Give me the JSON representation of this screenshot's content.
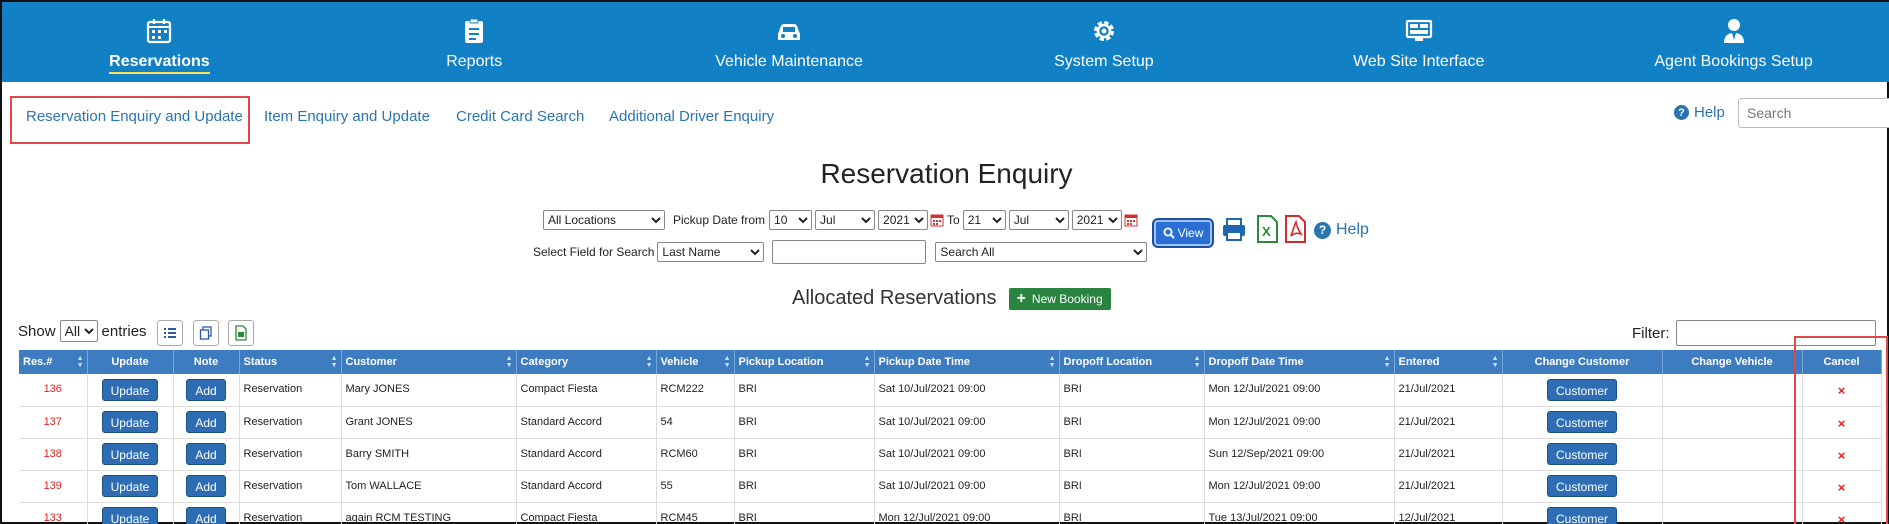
{
  "topnav": {
    "items": [
      {
        "label": "Reservations",
        "icon": "calendar-icon",
        "active": true
      },
      {
        "label": "Reports",
        "icon": "clipboard-icon",
        "active": false
      },
      {
        "label": "Vehicle Maintenance",
        "icon": "car-icon",
        "active": false
      },
      {
        "label": "System Setup",
        "icon": "gear-icon",
        "active": false
      },
      {
        "label": "Web Site Interface",
        "icon": "monitor-icon",
        "active": false
      },
      {
        "label": "Agent Bookings Setup",
        "icon": "agent-icon",
        "active": false
      }
    ],
    "bg_color": "#1180c4"
  },
  "subnav": {
    "tabs": [
      {
        "label": "Reservation Enquiry and Update",
        "active": true
      },
      {
        "label": "Item Enquiry and Update"
      },
      {
        "label": "Credit Card Search"
      },
      {
        "label": "Additional Driver Enquiry"
      }
    ],
    "help_label": "Help",
    "search_placeholder": "Search"
  },
  "page": {
    "title": "Reservation Enquiry"
  },
  "filters": {
    "location": "All Locations",
    "pickup_label": "Pickup Date from",
    "from_day": "10",
    "from_month": "Jul",
    "from_year": "2021",
    "to_label": "To",
    "to_day": "21",
    "to_month": "Jul",
    "to_year": "2021",
    "view_label": "View",
    "help_label": "Help",
    "field_label": "Select Field for Search",
    "field_value": "Last Name",
    "search_value": "",
    "search_scope": "Search All"
  },
  "allocated": {
    "heading": "Allocated Reservations",
    "new_booking_label": "New Booking"
  },
  "table_controls": {
    "show_label": "Show",
    "show_value": "All",
    "entries_label": "entries",
    "filter_label": "Filter:"
  },
  "table": {
    "headers": [
      "Res.#",
      "Update",
      "Note",
      "Status",
      "Customer",
      "Category",
      "Vehicle",
      "Pickup Location",
      "Pickup Date Time",
      "Dropoff Location",
      "Dropoff Date Time",
      "Entered",
      "Change Customer",
      "Change Vehicle",
      "Cancel"
    ],
    "update_label": "Update",
    "note_label": "Add",
    "customer_btn_label": "Customer",
    "cancel_symbol": "×",
    "rows": [
      {
        "res": "136",
        "status": "Reservation",
        "customer": "Mary JONES",
        "category": "Compact Fiesta",
        "vehicle": "RCM222",
        "pickup_loc": "BRI",
        "pickup_dt": "Sat 10/Jul/2021 09:00",
        "dropoff_loc": "BRI",
        "dropoff_dt": "Mon 12/Jul/2021 09:00",
        "entered": "21/Jul/2021"
      },
      {
        "res": "137",
        "status": "Reservation",
        "customer": "Grant JONES",
        "category": "Standard Accord",
        "vehicle": "54",
        "pickup_loc": "BRI",
        "pickup_dt": "Sat 10/Jul/2021 09:00",
        "dropoff_loc": "BRI",
        "dropoff_dt": "Mon 12/Jul/2021 09:00",
        "entered": "21/Jul/2021"
      },
      {
        "res": "138",
        "status": "Reservation",
        "customer": "Barry SMITH",
        "category": "Standard Accord",
        "vehicle": "RCM60",
        "pickup_loc": "BRI",
        "pickup_dt": "Sat 10/Jul/2021 09:00",
        "dropoff_loc": "BRI",
        "dropoff_dt": "Sun 12/Sep/2021 09:00",
        "entered": "21/Jul/2021"
      },
      {
        "res": "139",
        "status": "Reservation",
        "customer": "Tom WALLACE",
        "category": "Standard Accord",
        "vehicle": "55",
        "pickup_loc": "BRI",
        "pickup_dt": "Sat 10/Jul/2021 09:00",
        "dropoff_loc": "BRI",
        "dropoff_dt": "Mon 12/Jul/2021 09:00",
        "entered": "21/Jul/2021"
      },
      {
        "res": "133",
        "status": "Reservation",
        "customer": "again RCM TESTING",
        "category": "Compact Fiesta",
        "vehicle": "RCM45",
        "pickup_loc": "BRI",
        "pickup_dt": "Mon 12/Jul/2021 09:00",
        "dropoff_loc": "BRI",
        "dropoff_dt": "Tue 13/Jul/2021 09:00",
        "entered": "12/Jul/2021"
      }
    ]
  }
}
